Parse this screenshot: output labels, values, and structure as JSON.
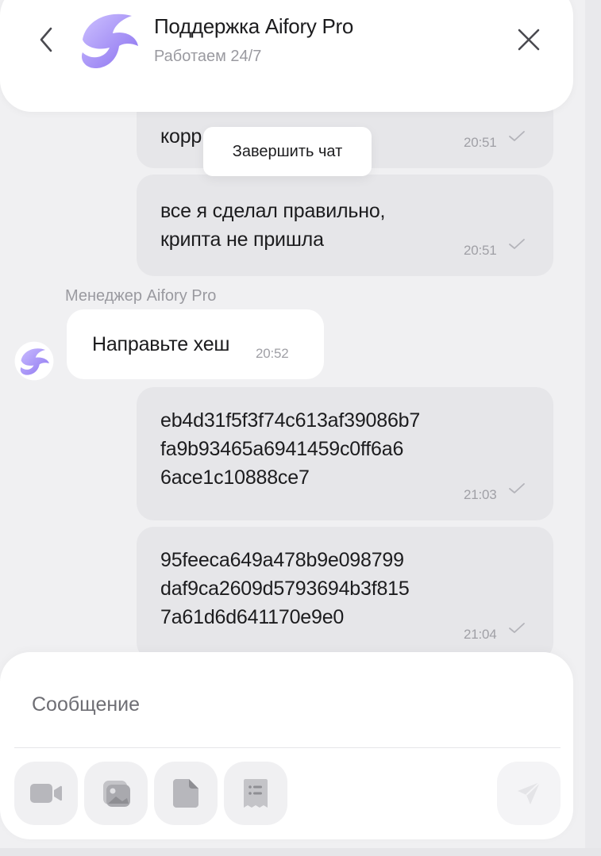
{
  "header": {
    "title": "Поддержка Aifory Pro",
    "subtitle": "Работаем 24/7",
    "back_icon": "chevron-left-icon",
    "close_icon": "close-icon"
  },
  "tooltip": {
    "label": "Завершить чат"
  },
  "messages": [
    {
      "from": "user",
      "text": "корр",
      "time": "20:51",
      "status": "sent"
    },
    {
      "from": "user",
      "text": "все я сделал правильно,\nкрипта не пришла",
      "time": "20:51",
      "status": "sent"
    },
    {
      "from": "manager",
      "sender": "Менеджер Aifory Pro",
      "text": "Направьте хеш",
      "time": "20:52"
    },
    {
      "from": "user",
      "text": "eb4d31f5f3f74c613af39086b7\nfa9b93465a6941459c0ff6a6\n6ace1c10888ce7",
      "time": "21:03",
      "status": "sent"
    },
    {
      "from": "user",
      "text": "95feeca649a478b9e098799\ndaf9ca2609d5793694b3f815\n7a61d6d641170e9e0",
      "time": "21:04",
      "status": "sent"
    }
  ],
  "composer": {
    "placeholder": "Сообщение",
    "tools": [
      "video-icon",
      "image-icon",
      "file-icon",
      "receipt-icon"
    ],
    "send_icon": "send-icon"
  },
  "colors": {
    "accent": "#9b87f5",
    "accent_light": "#c7b9ff",
    "bubble_user": "#e6e6e9",
    "bubble_manager": "#ffffff",
    "muted": "#9a9aa0"
  }
}
